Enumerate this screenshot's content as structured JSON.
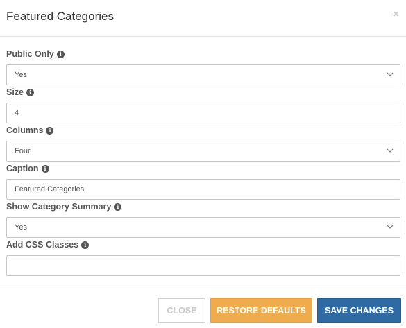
{
  "modal": {
    "title": "Featured Categories",
    "close_symbol": "×"
  },
  "fields": {
    "public_only": {
      "label": "Public Only",
      "value": "Yes",
      "type": "select"
    },
    "size": {
      "label": "Size",
      "value": "4",
      "type": "text"
    },
    "columns": {
      "label": "Columns",
      "value": "Four",
      "type": "select"
    },
    "caption": {
      "label": "Caption",
      "value": "Featured Categories",
      "type": "text"
    },
    "show_category_summary": {
      "label": "Show Category Summary",
      "value": "Yes",
      "type": "select"
    },
    "add_css_classes": {
      "label": "Add CSS Classes",
      "value": "",
      "type": "text"
    }
  },
  "info_icon_glyph": "i",
  "footer": {
    "close_label": "CLOSE",
    "restore_label": "RESTORE DEFAULTS",
    "save_label": "SAVE CHANGES"
  },
  "colors": {
    "restore_button": "#efac4e",
    "save_button": "#2f6aa3"
  }
}
